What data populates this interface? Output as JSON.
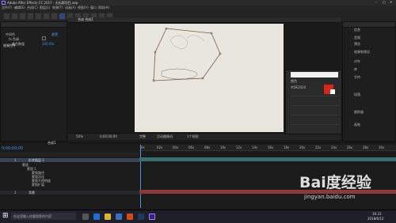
{
  "app": {
    "title": "Adobe After Effects CC 2017 - 无标题项目.aep"
  },
  "menu": [
    "文件(F)",
    "编辑(E)",
    "合成(C)",
    "图层(L)",
    "效果(T)",
    "动画(A)",
    "视图(V)",
    "窗口",
    "帮助(H)"
  ],
  "project_panel": {
    "tab": "效果控件",
    "rows": [
      {
        "label": "中间色",
        "value": "重置"
      },
      {
        "label": "fx 色调",
        "value": ""
      },
      {
        "label": "着色数量",
        "value": "100.0%"
      }
    ]
  },
  "comp_panel": {
    "tab": "合成 合成1",
    "zoom": "50%",
    "timecode": "0;00;00;00",
    "quality": "完整",
    "view": "活动摄像机",
    "views": "1个视图"
  },
  "color_dialog": {
    "title": "颜色",
    "hex": "#DE2020"
  },
  "right_panel": {
    "sections": [
      "信息",
      "音频",
      "预览",
      "效果和预设",
      "对齐",
      "库",
      "字符",
      "段落",
      "跟踪器",
      "画笔"
    ]
  },
  "timeline": {
    "tab": "合成1",
    "timecode": "0;00;00;00",
    "layers": [
      {
        "num": "1",
        "name": "形状图层 1"
      },
      {
        "num": "2",
        "name": "背景"
      }
    ],
    "properties": [
      "蒙版",
      "蒙版 1",
      "蒙版路径",
      "蒙版羽化",
      "蒙版不透明度",
      "蒙版扩展"
    ],
    "ruler_ticks": [
      "0s",
      "02s",
      "04s",
      "06s",
      "08s",
      "10s",
      "12s",
      "14s",
      "16s",
      "18s",
      "20s",
      "22s",
      "24s",
      "26s",
      "28s",
      "30s"
    ]
  },
  "taskbar": {
    "search": "在这里输入你要搜索的内容",
    "time": "16:23",
    "date": "2018/6/12"
  },
  "watermark": {
    "brand": "Bai度经验",
    "url": "jingyan.baidu.com"
  },
  "colors": {
    "accent": "#4f8fe8",
    "red_swatch": "#d9261c",
    "track_red": "#8b3a3a",
    "track_teal": "#3b6f6f"
  }
}
